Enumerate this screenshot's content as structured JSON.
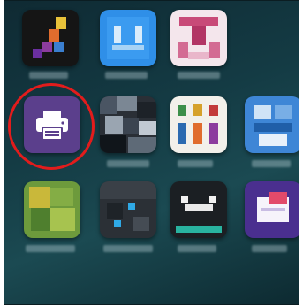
{
  "home_screen": {
    "apps": [
      {
        "id": "app-1",
        "label": "",
        "icon": "mosaic-app-icon"
      },
      {
        "id": "app-2",
        "label": "",
        "icon": "blue-tiles-icon"
      },
      {
        "id": "app-3",
        "label": "",
        "icon": "pink-logo-icon"
      },
      {
        "id": "print-app",
        "label": "",
        "icon": "printer-icon"
      },
      {
        "id": "app-5",
        "label": "",
        "icon": "dark-mosaic-icon"
      },
      {
        "id": "app-6",
        "label": "",
        "icon": "colorful-grid-icon"
      },
      {
        "id": "app-7",
        "label": "",
        "icon": "blue-disk-icon"
      },
      {
        "id": "app-8",
        "label": "",
        "icon": "green-tile-icon"
      },
      {
        "id": "app-9",
        "label": "",
        "icon": "dark-blocks-icon"
      },
      {
        "id": "app-10",
        "label": "",
        "icon": "dark-face-icon"
      },
      {
        "id": "app-11",
        "label": "",
        "icon": "purple-envelope-icon"
      }
    ],
    "highlight": {
      "target": "print-app",
      "color": "#e21c1c"
    }
  },
  "colors": {
    "wallpaper": "#143b44",
    "print_app_bg": "#5b3f8c",
    "highlight_ring": "#e21c1c"
  }
}
